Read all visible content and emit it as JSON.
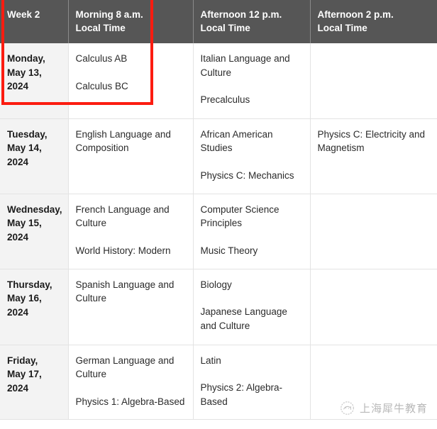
{
  "table": {
    "headers": [
      {
        "line1": "Week 2",
        "line2": ""
      },
      {
        "line1": "Morning 8 a.m.",
        "line2": "Local Time"
      },
      {
        "line1": "Afternoon 12 p.m.",
        "line2": "Local Time"
      },
      {
        "line1": "Afternoon 2 p.m.",
        "line2": "Local Time"
      }
    ],
    "rows": [
      {
        "day": "Monday,",
        "date": "May 13,",
        "year": "2024",
        "morning": [
          "Calculus AB",
          "Calculus BC"
        ],
        "afternoon12": [
          "Italian Language and Culture",
          "Precalculus"
        ],
        "afternoon2": []
      },
      {
        "day": "Tuesday,",
        "date": "May 14,",
        "year": "2024",
        "morning": [
          "English Language and Composition"
        ],
        "afternoon12": [
          "African American Studies",
          "Physics C: Mechanics"
        ],
        "afternoon2": [
          "Physics C: Electricity and Magnetism"
        ]
      },
      {
        "day": "Wednesday,",
        "date": "May 15,",
        "year": "2024",
        "morning": [
          "French Language and Culture",
          "World History: Modern"
        ],
        "afternoon12": [
          "Computer Science Principles",
          "Music Theory"
        ],
        "afternoon2": []
      },
      {
        "day": "Thursday,",
        "date": "May 16,",
        "year": "2024",
        "morning": [
          "Spanish Language and Culture"
        ],
        "afternoon12": [
          "Biology",
          "Japanese Language and Culture"
        ],
        "afternoon2": []
      },
      {
        "day": "Friday,",
        "date": "May 17,",
        "year": "2024",
        "morning": [
          "German Language and Culture",
          "Physics 1: Algebra-Based"
        ],
        "afternoon12": [
          "Latin",
          "Physics 2: Algebra-Based"
        ],
        "afternoon2": []
      }
    ]
  },
  "annotation": {
    "color": "#fc1c10",
    "shape": "rectangle"
  },
  "watermark": {
    "text": "上海犀牛教育",
    "icon": "rhino-circle-logo-icon",
    "color": "#8d8d8d"
  }
}
